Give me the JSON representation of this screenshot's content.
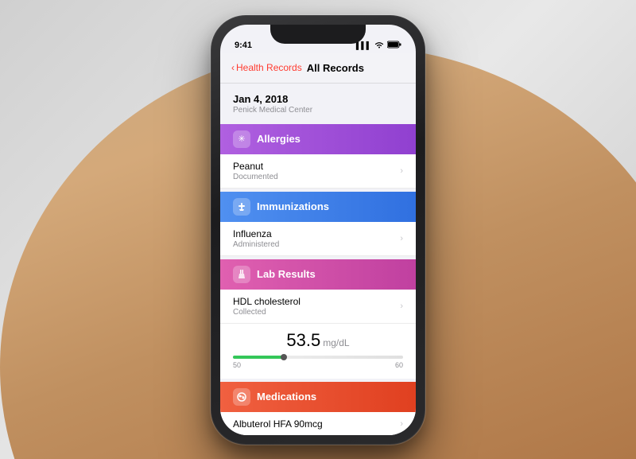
{
  "scene": {
    "background_color": "#e0d8d0"
  },
  "status_bar": {
    "time": "9:41",
    "signal_bars": "▌▌▌",
    "wifi": "wifi",
    "battery": "battery"
  },
  "nav": {
    "back_label": "Health Records",
    "title": "All Records"
  },
  "date_header": {
    "date": "Jan 4, 2018",
    "provider": "Penick Medical Center"
  },
  "sections": [
    {
      "id": "allergies",
      "label": "Allergies",
      "icon": "✳",
      "color_class": "allergies",
      "items": [
        {
          "title": "Peanut",
          "subtitle": "Documented"
        }
      ]
    },
    {
      "id": "immunizations",
      "label": "Immunizations",
      "icon": "💉",
      "color_class": "immunizations",
      "items": [
        {
          "title": "Influenza",
          "subtitle": "Administered"
        }
      ]
    },
    {
      "id": "lab_results",
      "label": "Lab Results",
      "icon": "📊",
      "color_class": "lab-results",
      "items": [
        {
          "title": "HDL cholesterol",
          "subtitle": "Collected"
        }
      ],
      "chart": {
        "value": "53.5",
        "unit": "mg/dL",
        "range_low": "50",
        "range_high": "60",
        "dot_position_percent": 30
      }
    },
    {
      "id": "medications",
      "label": "Medications",
      "icon": "💊",
      "color_class": "medications",
      "items": [
        {
          "title": "Albuterol HFA 90mcg",
          "subtitle": ""
        }
      ]
    }
  ]
}
